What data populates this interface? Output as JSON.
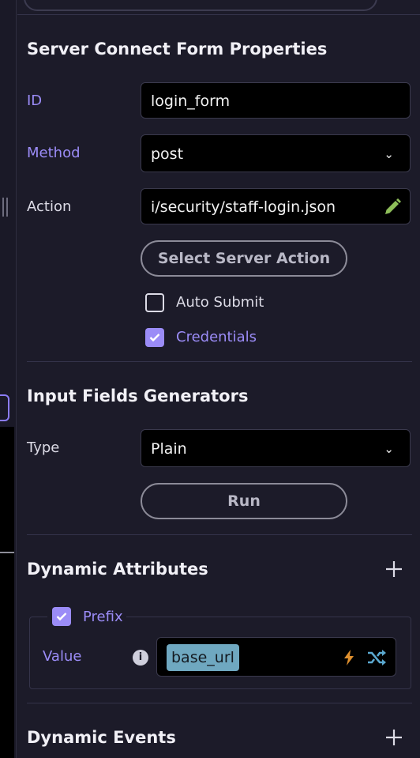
{
  "form": {
    "title": "Server Connect Form Properties",
    "id": {
      "label": "ID",
      "value": "login_form"
    },
    "method": {
      "label": "Method",
      "value": "post"
    },
    "action": {
      "label": "Action",
      "value": "i/security/staff-login.json",
      "edit_icon": "pencil-icon"
    },
    "select_server_action_label": "Select Server Action",
    "auto_submit": {
      "label": "Auto Submit",
      "checked": false
    },
    "credentials": {
      "label": "Credentials",
      "checked": true
    }
  },
  "generators": {
    "title": "Input Fields Generators",
    "type": {
      "label": "Type",
      "value": "Plain"
    },
    "run_label": "Run"
  },
  "dynamic_attributes": {
    "title": "Dynamic Attributes",
    "add_icon": "plus-icon",
    "prefix": {
      "label": "Prefix",
      "checked": true,
      "value_label": "Value",
      "value_chip": "base_url",
      "icons": [
        "info-icon",
        "lightning-icon",
        "shuffle-icon"
      ]
    }
  },
  "dynamic_events": {
    "title": "Dynamic Events",
    "add_icon": "plus-icon"
  },
  "colors": {
    "accent": "#9b8cf7",
    "background": "#1c1b29",
    "chip": "#6fa8c0",
    "pencil": "#8fbf5a",
    "lightning": "#e0902e",
    "shuffle": "#5ba9d0"
  }
}
